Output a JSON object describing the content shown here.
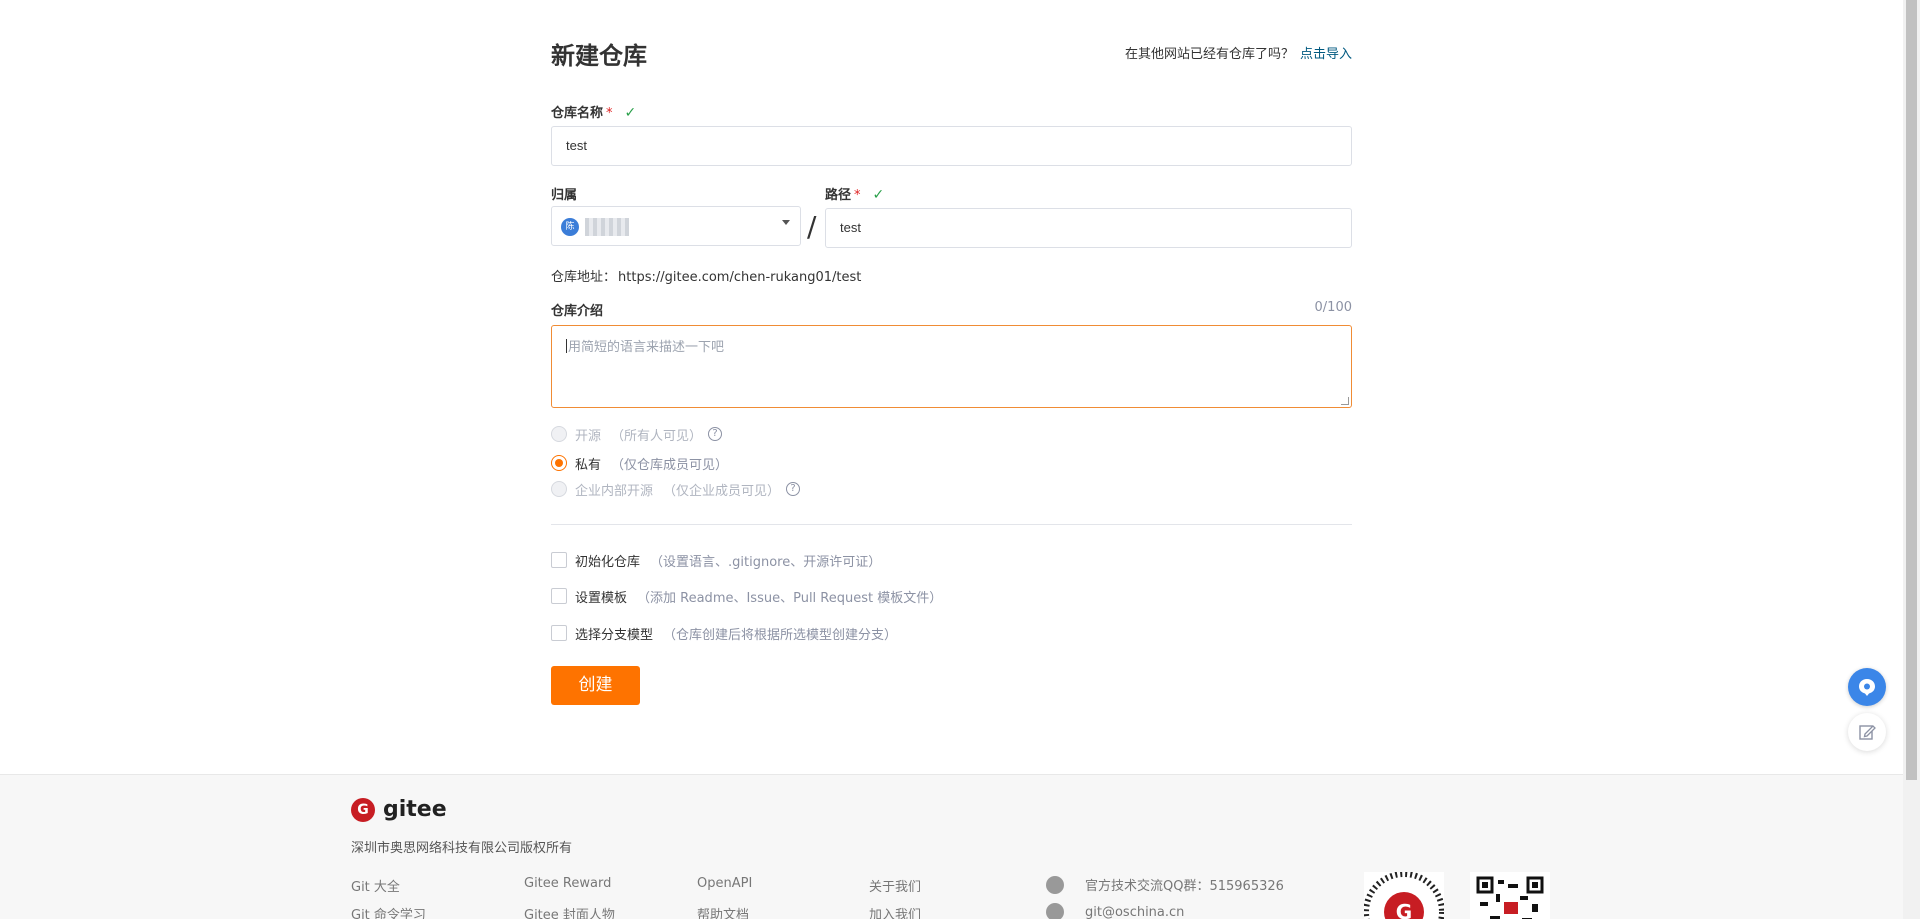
{
  "header": {
    "title": "新建仓库",
    "import_question": "在其他网站已经有仓库了吗？",
    "import_link": "点击导入"
  },
  "repo_name": {
    "label": "仓库名称",
    "required_mark": "*",
    "value": "test",
    "valid": true
  },
  "owner": {
    "label": "归属",
    "avatar_text": "陈"
  },
  "path": {
    "label": "路径",
    "required_mark": "*",
    "separator": "/",
    "value": "test",
    "valid": true
  },
  "address": {
    "label": "仓库地址：",
    "value": "https://gitee.com/chen-rukang01/test"
  },
  "description": {
    "label": "仓库介绍",
    "counter": "0/100",
    "placeholder": "用简短的语言来描述一下吧"
  },
  "visibility": {
    "options": [
      {
        "label": "开源",
        "hint": "（所有人可见）",
        "selected": false,
        "disabled": true,
        "help": true
      },
      {
        "label": "私有",
        "hint": "（仅仓库成员可见）",
        "selected": true,
        "disabled": false,
        "help": false
      },
      {
        "label": "企业内部开源",
        "hint": "（仅企业成员可见）",
        "selected": false,
        "disabled": true,
        "help": true
      }
    ]
  },
  "options": [
    {
      "label": "初始化仓库",
      "hint": "（设置语言、.gitignore、开源许可证）",
      "checked": false
    },
    {
      "label": "设置模板",
      "hint": "（添加 Readme、Issue、Pull Request 模板文件）",
      "checked": false
    },
    {
      "label": "选择分支模型",
      "hint": "（仓库创建后将根据所选模型创建分支）",
      "checked": false
    }
  ],
  "create_button": "创建",
  "footer": {
    "logo_text": "gitee",
    "copyright": "深圳市奥思网络科技有限公司版权所有",
    "links_col1": [
      "Git 大全",
      "Git 命令学习"
    ],
    "links_col2": [
      "Gitee Reward",
      "Gitee 封面人物"
    ],
    "links_col3": [
      "OpenAPI",
      "帮助文档"
    ],
    "links_col4": [
      "关于我们",
      "加入我们"
    ],
    "contacts": [
      "官方技术交流QQ群：515965326",
      "git@oschina.cn"
    ]
  },
  "colors": {
    "accent": "#fe7300",
    "link": "#005980",
    "valid_check": "#2aa04a",
    "required": "#e02020",
    "brand": "#c71d23"
  }
}
